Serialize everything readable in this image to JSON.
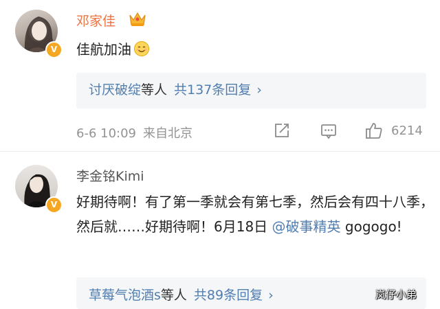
{
  "comments": [
    {
      "username": "邓家佳",
      "text": "佳航加油",
      "reply_summary": {
        "names": "讨厌破绽",
        "mid": "等人",
        "count": "共137条回复"
      },
      "date": "6-6 10:09",
      "source": "来自北京",
      "likes": "6214"
    },
    {
      "username": "李金铭Kimi",
      "text_before": "好期待啊！有了第一季就会有第七季，然后会有四十八季，然后就……好期待啊！6月18日 ",
      "mention": "@破事精英",
      "text_after": " gogogo!",
      "reply_summary": {
        "names": "草莓气泡酒s",
        "mid": "等人",
        "count": "共89条回复"
      }
    }
  ],
  "icons": {
    "verified": "v-badge-icon",
    "crown": "crown-icon",
    "share": "share-icon",
    "comment": "comment-icon",
    "like": "thumbs-up-icon",
    "chevron": "chevron-right-icon",
    "emoji": "smile-emoji-icon"
  },
  "colors": {
    "username_vip": "#eb7340",
    "username": "#555555",
    "link": "#507daf",
    "meta": "#939393",
    "badge": "#f5a623",
    "reply_bg": "#f5f6f8"
  },
  "watermark": "岚仔小弟"
}
